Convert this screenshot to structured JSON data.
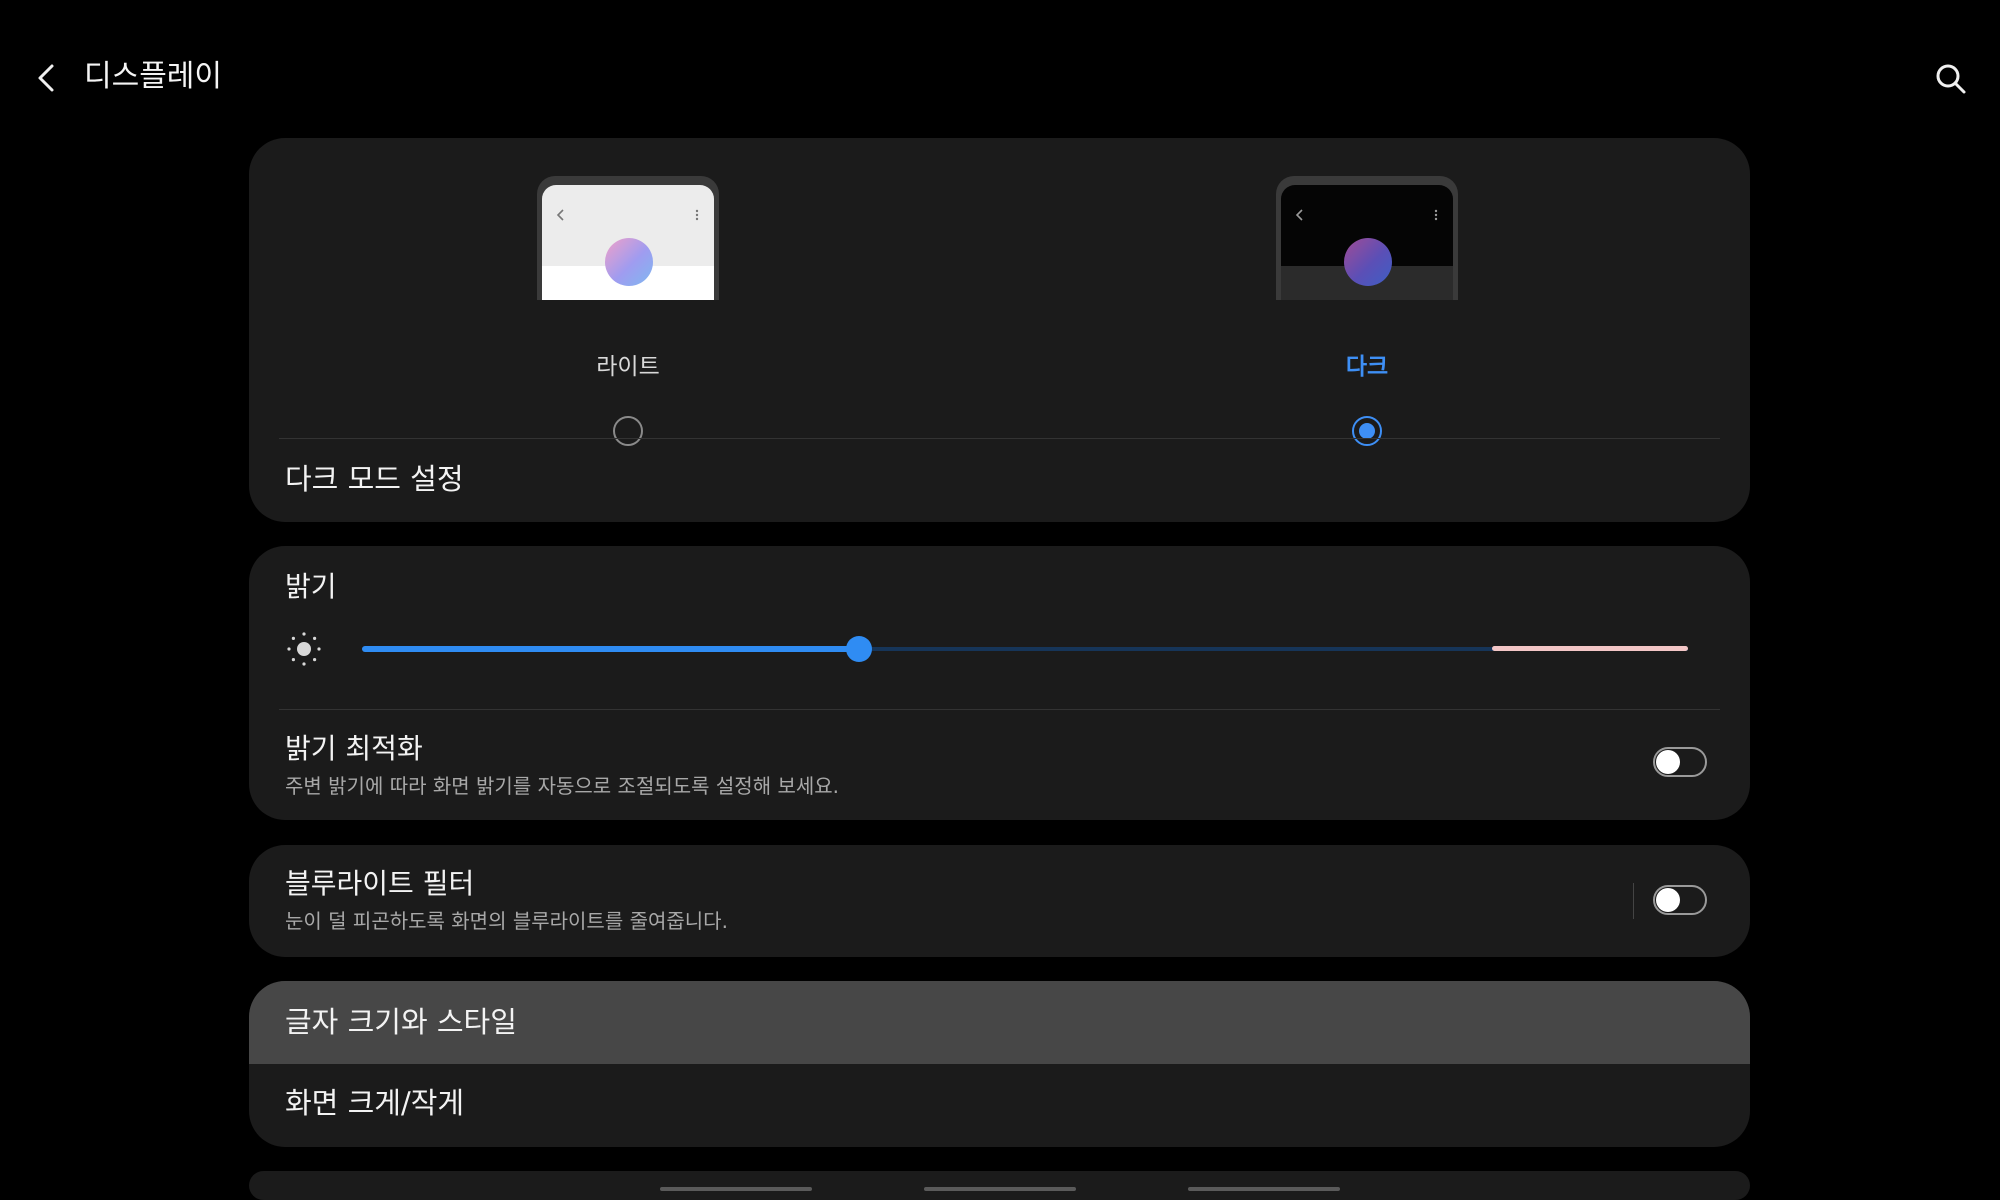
{
  "header": {
    "title": "디스플레이",
    "back_icon": "chevron-left-icon",
    "search_icon": "search-icon"
  },
  "theme": {
    "options": [
      {
        "label": "라이트",
        "selected": false
      },
      {
        "label": "다크",
        "selected": true
      }
    ],
    "dark_mode_settings_label": "다크 모드 설정"
  },
  "brightness": {
    "title": "밝기",
    "level_percent": 37.5,
    "optimization_title": "밝기 최적화",
    "optimization_subtitle": "주변 밝기에 따라 화면 밝기를 자동으로 조절되도록 설정해 보세요.",
    "optimization_enabled": false
  },
  "blue_light": {
    "title": "블루라이트 필터",
    "subtitle": "눈이 덜 피곤하도록 화면의 블루라이트를 줄여줍니다.",
    "enabled": false
  },
  "font": {
    "size_style_label": "글자 크기와 스타일",
    "screen_zoom_label": "화면 크게/작게"
  },
  "colors": {
    "accent": "#3e8ff5",
    "background": "#000000",
    "card": "#1b1b1b"
  }
}
